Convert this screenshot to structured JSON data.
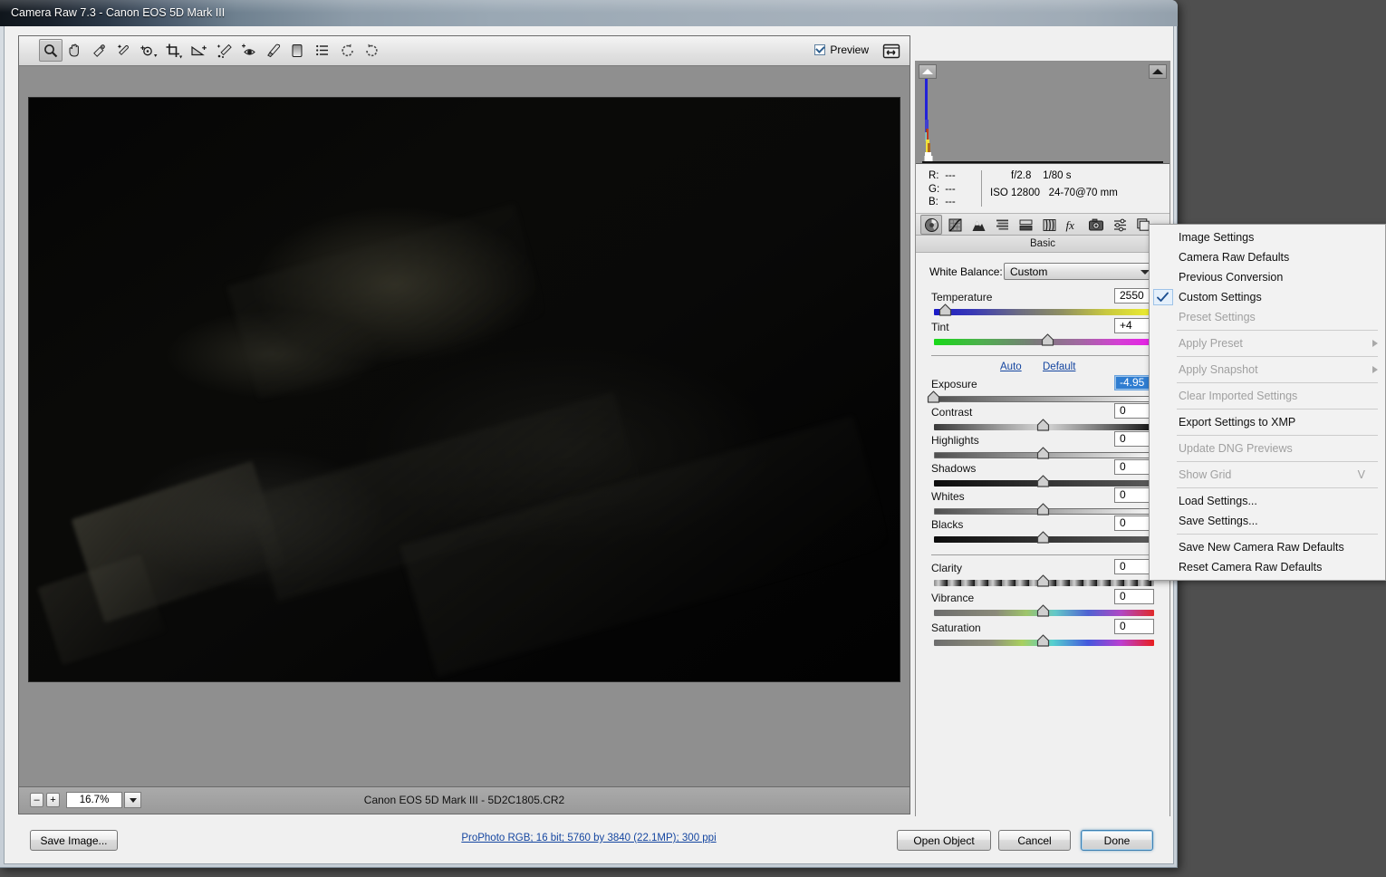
{
  "window": {
    "title": "Camera Raw 7.3  -  Canon EOS 5D Mark III"
  },
  "toolbar": {
    "tools": [
      {
        "name": "zoom-tool",
        "selected": true
      },
      {
        "name": "hand-tool",
        "selected": false
      },
      {
        "name": "white-balance-eyedropper-tool",
        "selected": false
      },
      {
        "name": "color-sampler-tool",
        "selected": false
      },
      {
        "name": "targeted-adjustment-tool",
        "selected": false
      },
      {
        "name": "crop-tool",
        "selected": false
      },
      {
        "name": "straighten-tool",
        "selected": false
      },
      {
        "name": "spot-removal-tool",
        "selected": false
      },
      {
        "name": "red-eye-removal-tool",
        "selected": false
      },
      {
        "name": "adjustment-brush-tool",
        "selected": false
      },
      {
        "name": "graduated-filter-tool",
        "selected": false
      },
      {
        "name": "open-preferences-tool",
        "selected": false
      },
      {
        "name": "rotate-counterclockwise-tool",
        "selected": false
      },
      {
        "name": "rotate-clockwise-tool",
        "selected": false
      }
    ],
    "preview_label": "Preview",
    "preview_checked": true,
    "fullscreen_name": "toggle-fullscreen-icon"
  },
  "status": {
    "zoom_minus": "–",
    "zoom_plus": "+",
    "zoom_value": "16.7%",
    "file_label": "Canon EOS 5D Mark III  -  5D2C1805.CR2"
  },
  "histogram": {
    "shadow_arrow_name": "shadow-clipping-warning",
    "highlight_arrow_name": "highlight-clipping-warning"
  },
  "info": {
    "r_label": "R:",
    "r_value": "---",
    "g_label": "G:",
    "g_value": "---",
    "b_label": "B:",
    "b_value": "---",
    "aperture": "f/2.8",
    "shutter": "1/80 s",
    "iso": "ISO 12800",
    "lens": "24-70@70 mm"
  },
  "panel_tabs": [
    {
      "name": "tab-basic",
      "label": "Basic",
      "active": true
    },
    {
      "name": "tab-tone-curve",
      "label": "Tone Curve",
      "active": false
    },
    {
      "name": "tab-detail",
      "label": "Detail",
      "active": false
    },
    {
      "name": "tab-hsl-grayscale",
      "label": "HSL / Grayscale",
      "active": false
    },
    {
      "name": "tab-split-toning",
      "label": "Split Toning",
      "active": false
    },
    {
      "name": "tab-lens-corrections",
      "label": "Lens Corrections",
      "active": false
    },
    {
      "name": "tab-effects",
      "label": "Effects",
      "active": false
    },
    {
      "name": "tab-camera-calibration",
      "label": "Camera Calibration",
      "active": false
    },
    {
      "name": "tab-presets",
      "label": "Presets",
      "active": false
    },
    {
      "name": "tab-snapshots",
      "label": "Snapshots",
      "active": false
    }
  ],
  "panel": {
    "title": "Basic",
    "menu_icon": "panel-menu-icon"
  },
  "basic": {
    "white_balance_label": "White Balance:",
    "white_balance_value": "Custom",
    "auto_label": "Auto",
    "default_label": "Default",
    "sliders": [
      {
        "name": "temperature",
        "label": "Temperature",
        "value": "2550",
        "pos": 6,
        "track": "temp"
      },
      {
        "name": "tint",
        "label": "Tint",
        "value": "+4",
        "pos": 52,
        "track": "tint"
      },
      {
        "name": "exposure",
        "label": "Exposure",
        "value": "-4.95",
        "pos": 1,
        "track": "gray-white",
        "selected": true
      },
      {
        "name": "contrast",
        "label": "Contrast",
        "value": "0",
        "pos": 50,
        "track": "contrastish"
      },
      {
        "name": "highlights",
        "label": "Highlights",
        "value": "0",
        "pos": 50,
        "track": "gray-white"
      },
      {
        "name": "shadows",
        "label": "Shadows",
        "value": "0",
        "pos": 50,
        "track": "black-gray"
      },
      {
        "name": "whites",
        "label": "Whites",
        "value": "0",
        "pos": 50,
        "track": "gray-white"
      },
      {
        "name": "blacks",
        "label": "Blacks",
        "value": "0",
        "pos": 50,
        "track": "black-gray"
      },
      {
        "name": "clarity",
        "label": "Clarity",
        "value": "0",
        "pos": 50,
        "track": "clarity"
      },
      {
        "name": "vibrance",
        "label": "Vibrance",
        "value": "0",
        "pos": 50,
        "track": "vib"
      },
      {
        "name": "saturation",
        "label": "Saturation",
        "value": "0",
        "pos": 50,
        "track": "sat"
      }
    ]
  },
  "context_menu": {
    "items": [
      {
        "label": "Image Settings",
        "disabled": false,
        "checked": false,
        "submenu": false,
        "shortcut": "",
        "sep_after": false
      },
      {
        "label": "Camera Raw Defaults",
        "disabled": false,
        "checked": false,
        "submenu": false,
        "shortcut": "",
        "sep_after": false
      },
      {
        "label": "Previous Conversion",
        "disabled": false,
        "checked": false,
        "submenu": false,
        "shortcut": "",
        "sep_after": false
      },
      {
        "label": "Custom Settings",
        "disabled": false,
        "checked": true,
        "submenu": false,
        "shortcut": "",
        "sep_after": false
      },
      {
        "label": "Preset Settings",
        "disabled": true,
        "checked": false,
        "submenu": false,
        "shortcut": "",
        "sep_after": true
      },
      {
        "label": "Apply Preset",
        "disabled": true,
        "checked": false,
        "submenu": true,
        "shortcut": "",
        "sep_after": true
      },
      {
        "label": "Apply Snapshot",
        "disabled": true,
        "checked": false,
        "submenu": true,
        "shortcut": "",
        "sep_after": true
      },
      {
        "label": "Clear Imported Settings",
        "disabled": true,
        "checked": false,
        "submenu": false,
        "shortcut": "",
        "sep_after": true
      },
      {
        "label": "Export Settings to XMP",
        "disabled": false,
        "checked": false,
        "submenu": false,
        "shortcut": "",
        "sep_after": true
      },
      {
        "label": "Update DNG Previews",
        "disabled": true,
        "checked": false,
        "submenu": false,
        "shortcut": "",
        "sep_after": true
      },
      {
        "label": "Show Grid",
        "disabled": true,
        "checked": false,
        "submenu": false,
        "shortcut": "V",
        "sep_after": true
      },
      {
        "label": "Load Settings...",
        "disabled": false,
        "checked": false,
        "submenu": false,
        "shortcut": "",
        "sep_after": false
      },
      {
        "label": "Save Settings...",
        "disabled": false,
        "checked": false,
        "submenu": false,
        "shortcut": "",
        "sep_after": true
      },
      {
        "label": "Save New Camera Raw Defaults",
        "disabled": false,
        "checked": false,
        "submenu": false,
        "shortcut": "",
        "sep_after": false
      },
      {
        "label": "Reset Camera Raw Defaults",
        "disabled": false,
        "checked": false,
        "submenu": false,
        "shortcut": "",
        "sep_after": false
      }
    ]
  },
  "footer": {
    "save_image_label": "Save Image...",
    "color_link": "ProPhoto RGB; 16 bit; 5760 by 3840 (22.1MP); 300 ppi",
    "open_object_label": "Open Object",
    "cancel_label": "Cancel",
    "done_label": "Done"
  },
  "colors": {
    "accent_blue": "#2f7dd1",
    "link_blue": "#1546a0",
    "panel_bg": "#f0f0f0",
    "image_bg": "#8f8f8f"
  }
}
